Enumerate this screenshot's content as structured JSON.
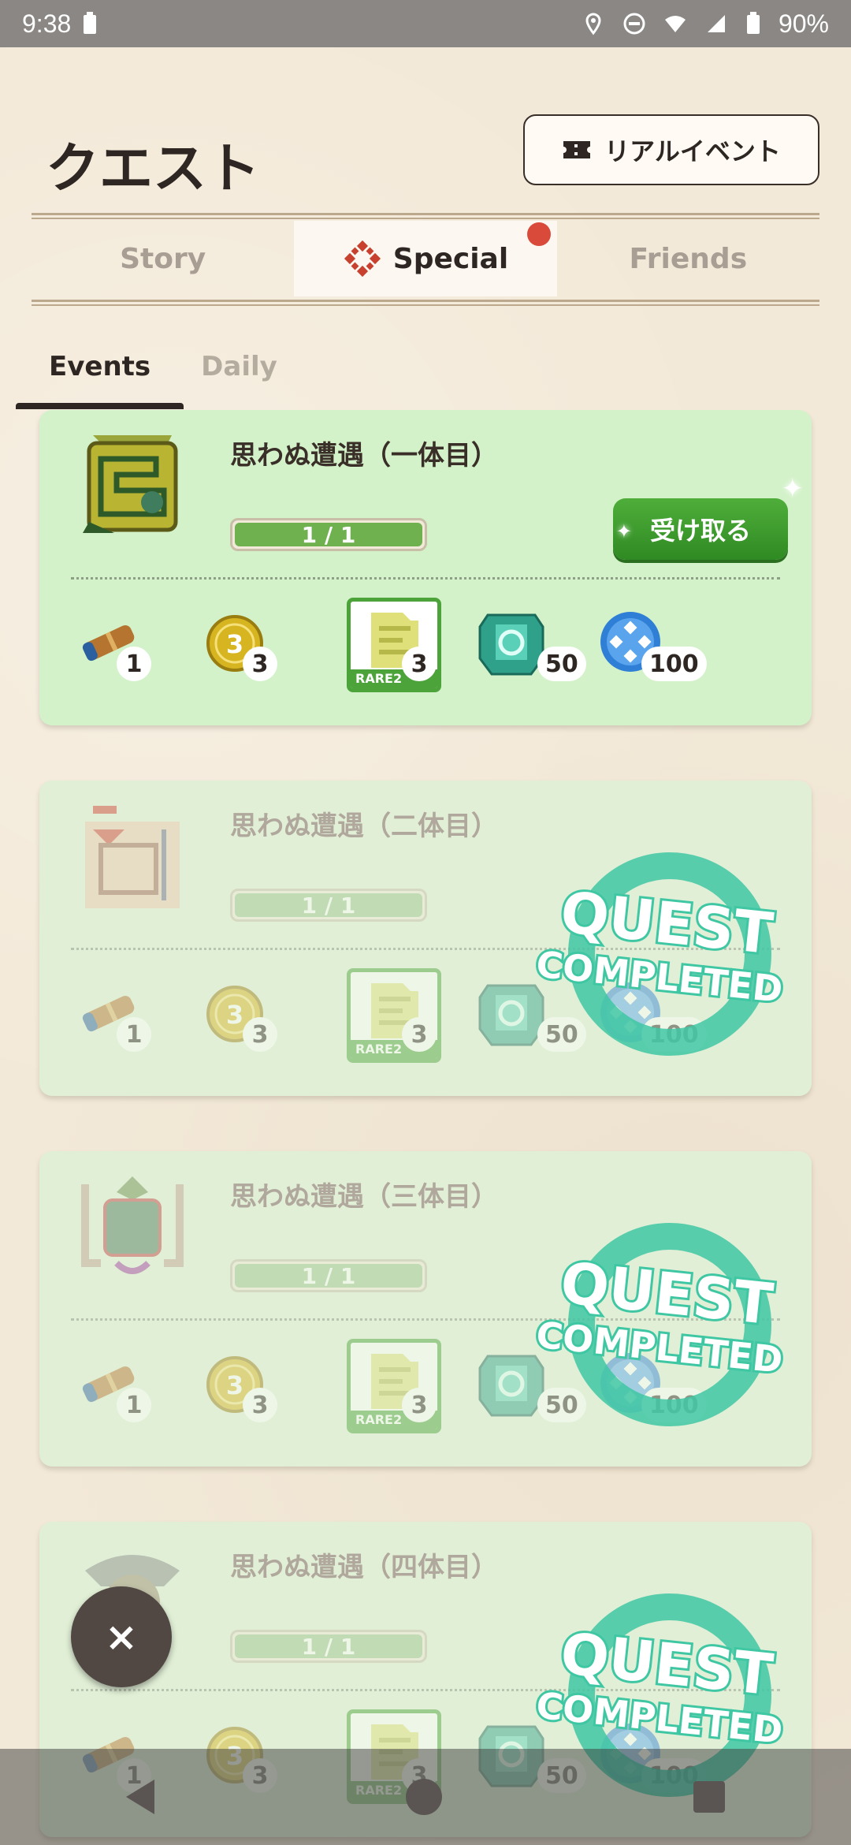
{
  "status": {
    "time": "9:38",
    "battery": "90%"
  },
  "header": {
    "title": "クエスト",
    "real_event_label": "リアルイベント"
  },
  "tabs": [
    {
      "label": "Story"
    },
    {
      "label": "Special"
    },
    {
      "label": "Friends"
    }
  ],
  "subtabs": [
    {
      "label": "Events"
    },
    {
      "label": "Daily"
    }
  ],
  "quests": [
    {
      "title": "思わぬ遭遇（一体目）",
      "progress_text": "1 / 1",
      "progress": 1.0,
      "completed": false,
      "claim_label": "受け取る",
      "rewards": [
        "1",
        "3",
        "3",
        "50",
        "100"
      ],
      "rare_tag": "RARE2"
    },
    {
      "title": "思わぬ遭遇（二体目）",
      "progress_text": "1 / 1",
      "progress": 1.0,
      "completed": true,
      "rewards": [
        "1",
        "3",
        "3",
        "50",
        "100"
      ],
      "rare_tag": "RARE2"
    },
    {
      "title": "思わぬ遭遇（三体目）",
      "progress_text": "1 / 1",
      "progress": 1.0,
      "completed": true,
      "rewards": [
        "1",
        "3",
        "3",
        "50",
        "100"
      ],
      "rare_tag": "RARE2"
    },
    {
      "title": "思わぬ遭遇（四体目）",
      "progress_text": "1 / 1",
      "progress": 1.0,
      "completed": true,
      "rewards": [
        "1",
        "3",
        "3",
        "50",
        "100"
      ],
      "rare_tag": "RARE2"
    }
  ],
  "stamp_text": {
    "line1": "QUEST",
    "line2": "COMPLETED"
  },
  "fab": {
    "close_label": "×"
  },
  "icons": {
    "telescope": "telescope-icon",
    "coin": "coin-icon",
    "material": "rare-material-icon",
    "gem": "gem-icon",
    "orb": "orb-icon"
  },
  "colors": {
    "accent_green": "#4fae3a",
    "card_bg": "#d3f2c9",
    "badge_red": "#d94a3a",
    "stamp": "#3fc7a3"
  }
}
